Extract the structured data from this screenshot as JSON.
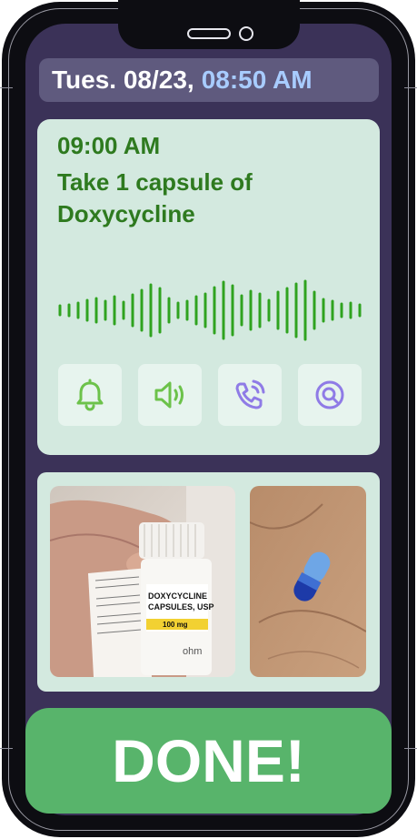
{
  "status_bar": {
    "date": "Tues. 08/23,",
    "time": "08:50 AM"
  },
  "reminder": {
    "time": "09:00 AM",
    "instruction": "Take 1 capsule of Doxycycline"
  },
  "actions": [
    {
      "icon": "bell-icon"
    },
    {
      "icon": "speaker-icon"
    },
    {
      "icon": "phone-call-icon"
    },
    {
      "icon": "search-icon"
    }
  ],
  "photos": {
    "bottle": {
      "label_line1": "DOXYCYCLINE",
      "label_line2": "CAPSULES, USP",
      "strength": "100 mg",
      "brand": "ohm"
    },
    "capsule": {}
  },
  "done_button": {
    "label": "DONE!"
  },
  "colors": {
    "background": "#3b3258",
    "card": "#d3e9df",
    "accent_green": "#2e7a1f",
    "time_highlight": "#a8ccff",
    "icon_green": "#6cc24a",
    "icon_purple": "#8f7be6",
    "done_green": "#58b46b"
  }
}
